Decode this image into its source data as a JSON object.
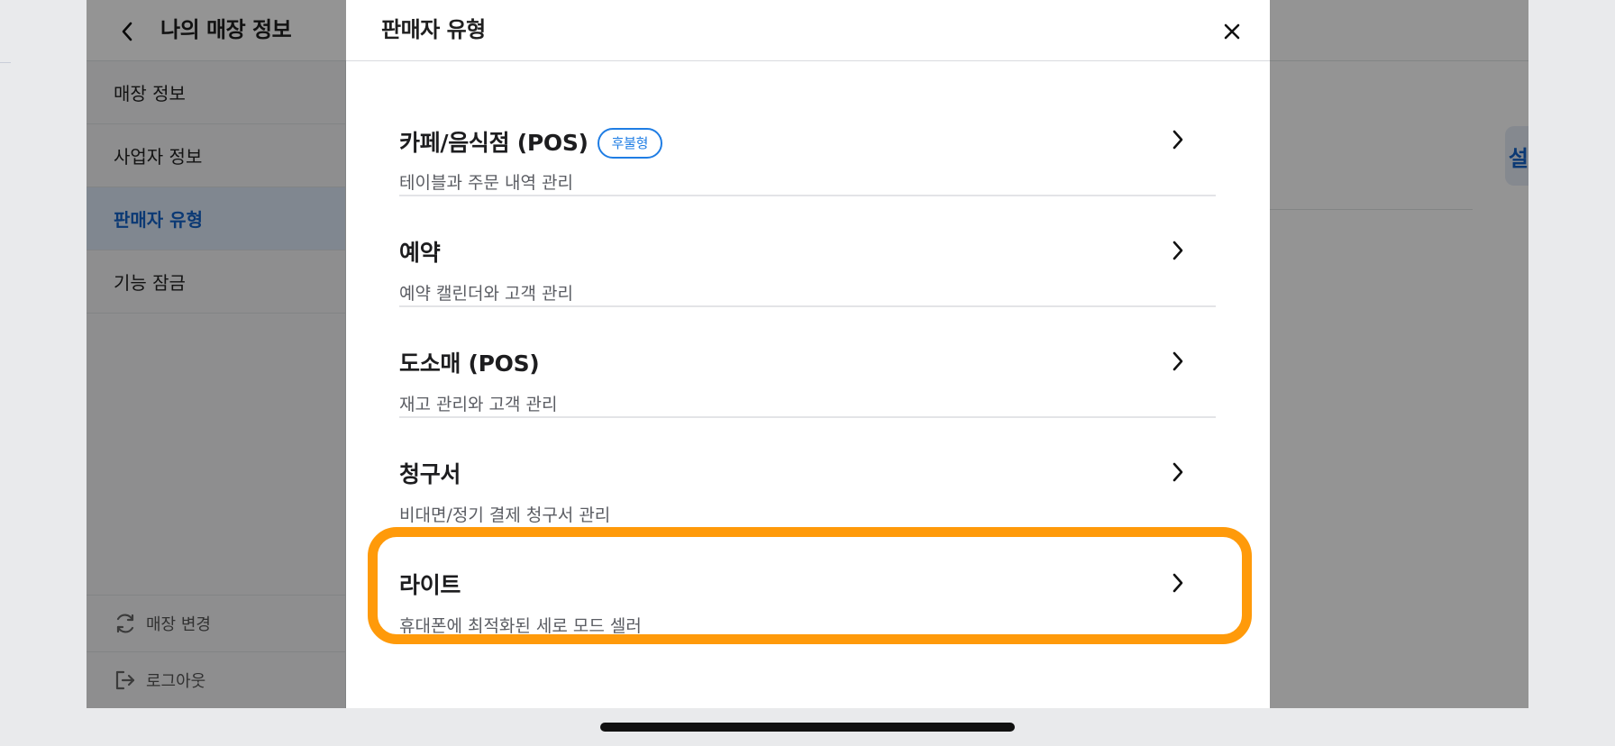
{
  "app": {
    "title": "나의 매장 정보",
    "sidebar": {
      "items": [
        {
          "label": "매장 정보"
        },
        {
          "label": "사업자 정보"
        },
        {
          "label": "판매자 유형"
        },
        {
          "label": "기능 잠금"
        }
      ],
      "footer": {
        "change_store_label": "매장 변경",
        "logout_label": "로그아웃"
      }
    },
    "main": {
      "settings_button_label": "설정"
    }
  },
  "modal": {
    "title": "판매자 유형",
    "options": [
      {
        "title": "카페/음식점 (POS)",
        "badge": "후불형",
        "subtitle": "테이블과 주문 내역 관리"
      },
      {
        "title": "예약",
        "subtitle": "예약 캘린더와 고객 관리"
      },
      {
        "title": "도소매 (POS)",
        "subtitle": "재고 관리와 고객 관리"
      },
      {
        "title": "청구서",
        "subtitle": "비대면/정기 결제 청구서 관리"
      },
      {
        "title": "라이트",
        "subtitle": "휴대폰에 최적화된 세로 모드 셀러"
      }
    ]
  },
  "colors": {
    "accent": "#1463c8",
    "badge": "#1f7de4",
    "highlight": "#ff9a0a",
    "overlay": "rgba(0,0,0,0.42)"
  },
  "icons": [
    "chevron-left-icon",
    "close-icon",
    "chevron-right-icon",
    "refresh-icon",
    "logout-icon"
  ]
}
